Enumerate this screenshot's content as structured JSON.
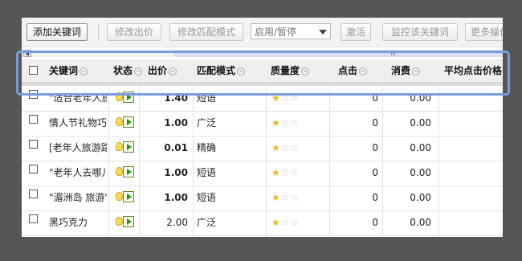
{
  "toolbar": {
    "add_keyword": "添加关键词",
    "change_bid": "修改出价",
    "change_match": "修改匹配模式",
    "status_select": "启用/暂停",
    "activate": "激活",
    "monitor": "监控该关键词",
    "more": "更多操作"
  },
  "columns": {
    "keyword": "关键词",
    "status": "状态",
    "bid": "出价",
    "match": "匹配模式",
    "quality": "质量度",
    "clicks": "点击",
    "cost": "消费",
    "avg_cpc": "平均点击价格"
  },
  "rows": [
    {
      "keyword": "\"适合老年人旅",
      "bid": "1.40",
      "bid_bold": true,
      "match": "短语",
      "quality": 1,
      "clicks": "0",
      "cost": "0.00"
    },
    {
      "keyword": "情人节礼物巧克",
      "bid": "1.00",
      "bid_bold": true,
      "match": "广泛",
      "quality": 1,
      "clicks": "0",
      "cost": "0.00"
    },
    {
      "keyword": "[老年人旅游路线",
      "bid": "0.01",
      "bid_bold": true,
      "match": "精确",
      "quality": 1,
      "clicks": "0",
      "cost": "0.00"
    },
    {
      "keyword": "\"老年人去哪儿旅",
      "bid": "1.00",
      "bid_bold": true,
      "match": "短语",
      "quality": 1,
      "clicks": "0",
      "cost": "0.00"
    },
    {
      "keyword": "\"湄洲岛 旅游\"",
      "bid": "1.00",
      "bid_bold": true,
      "match": "短语",
      "quality": 1,
      "clicks": "0",
      "cost": "0.00"
    },
    {
      "keyword": "黑巧克力",
      "bid": "2.00",
      "bid_bold": false,
      "match": "广泛",
      "quality": 1,
      "clicks": "0",
      "cost": "0.00"
    }
  ],
  "icons": {
    "status_bulb": "lightbulb-icon",
    "status_play": "play-icon",
    "quality": "star-icon",
    "sort": "sort-icon",
    "scroll_left": "scroll-left-arrow-icon"
  },
  "colors": {
    "highlight": "#7c9bdc",
    "star_on": "#e7b91f",
    "star_off": "#c8c8c8",
    "backdrop": "#565656"
  }
}
